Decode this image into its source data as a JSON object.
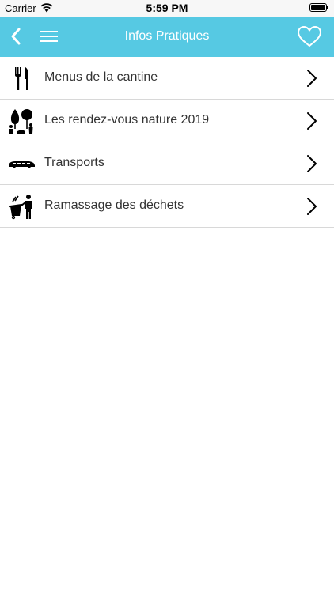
{
  "status_bar": {
    "carrier": "Carrier",
    "time": "5:59 PM",
    "wifi_icon": "wifi-icon",
    "battery_icon": "battery-icon"
  },
  "nav": {
    "title": "Infos Pratiques",
    "back_icon": "back-chevron-icon",
    "menu_icon": "hamburger-menu-icon",
    "favorite_icon": "heart-icon",
    "color": "#56c9e3"
  },
  "list": {
    "items": [
      {
        "label": "Menus de la cantine",
        "icon": "fork-knife-icon"
      },
      {
        "label": "Les rendez-vous nature 2019",
        "icon": "trees-people-icon"
      },
      {
        "label": "Transports",
        "icon": "bus-icon"
      },
      {
        "label": "Ramassage des déchets",
        "icon": "waste-collection-icon"
      }
    ]
  }
}
